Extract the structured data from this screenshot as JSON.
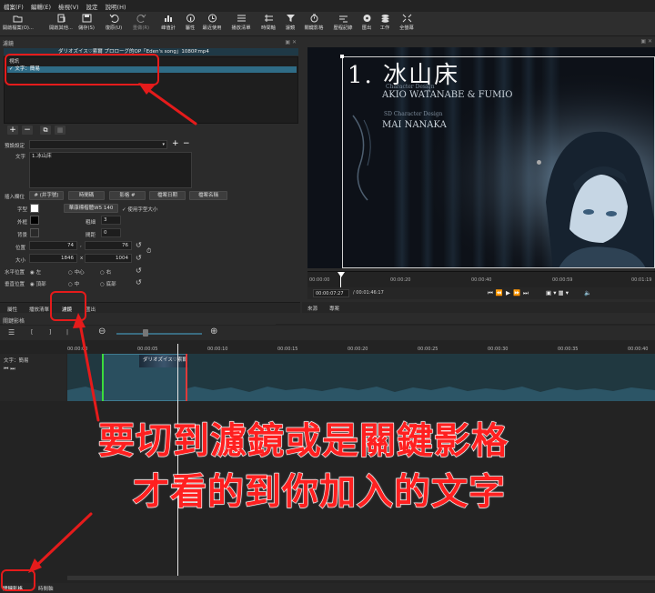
{
  "menu": {
    "items": [
      "檔案(F)",
      "編輯(E)",
      "檢視(V)",
      "設定",
      "說明(H)"
    ]
  },
  "toolbar": {
    "buttons": [
      {
        "label": "開啟檔案(O)...",
        "icon": "open-folder-icon"
      },
      {
        "label": "開啟其他...",
        "icon": "open-other-icon"
      },
      {
        "label": "儲存(S)",
        "icon": "save-icon"
      },
      {
        "label": "復原(U)",
        "icon": "undo-icon"
      },
      {
        "label": "重做(R)",
        "icon": "redo-icon"
      },
      {
        "label": "峰值計",
        "icon": "peak-meter-icon"
      },
      {
        "label": "屬性",
        "icon": "properties-icon"
      },
      {
        "label": "最近使用",
        "icon": "recent-icon"
      },
      {
        "label": "播放清單",
        "icon": "playlist-icon"
      },
      {
        "label": "時間軸",
        "icon": "timeline-icon"
      },
      {
        "label": "濾鏡",
        "icon": "filter-icon"
      },
      {
        "label": "關鍵影格",
        "icon": "keyframes-icon"
      },
      {
        "label": "歷程記錄",
        "icon": "history-icon"
      },
      {
        "label": "匯出",
        "icon": "export-icon"
      },
      {
        "label": "工作",
        "icon": "jobs-icon"
      },
      {
        "label": "全螢幕",
        "icon": "fullscreen-icon"
      }
    ]
  },
  "filters_panel": {
    "title": "濾鏡",
    "clip_name": "ダリオズイス♡索爾 プロローグ的ОP「Eden's song」1080P.mp4",
    "category": "視訊",
    "filter_item": "✓ 文字：簡易",
    "preset_label": "預設設定",
    "text_label": "文字",
    "text_value": "1.冰山床",
    "insert_field_label": "插入欄位",
    "insert_buttons": [
      "# (井字號)",
      "時間碼",
      "影格 #",
      "檔案日期",
      "檔案名稱"
    ],
    "font_label": "字型",
    "font_button": "華康標楷體W5 140",
    "use_font_size": "✓ 使用字型大小",
    "outline_label": "外框",
    "thickness_label": "粗細",
    "thickness_value": "3",
    "background_label": "背景",
    "padding_label": "間距",
    "padding_value": "0",
    "position_label": "位置",
    "pos_x": "74",
    "pos_y": "76",
    "size_label": "大小",
    "size_w": "1846",
    "size_h": "1004",
    "halign_label": "水平位置",
    "halign_options": [
      "左",
      "中心",
      "右"
    ],
    "valign_label": "垂直位置",
    "valign_options": [
      "頂部",
      "中",
      "底部"
    ],
    "tabs": [
      "屬性",
      "播放清單",
      "濾鏡",
      "匯出"
    ]
  },
  "preview": {
    "title_text": "1. 冰山床",
    "credit_small_1": "Character Design",
    "credit_line_1": "AKIO WATANABE & FUMIO",
    "credit_small_2": "SD Character Design",
    "credit_line_2": "MAI NANAKA",
    "ruler_ticks": [
      "00:00:00",
      "00:00:20",
      "00:00:40",
      "00:00:59",
      "00:01:19"
    ],
    "current_time": "00:00:07:27",
    "total_time": "/ 00:01:46:17",
    "source_tab": "來源",
    "project_tab": "專案"
  },
  "timeline": {
    "title": "關鍵影格",
    "ticks": [
      "00:00:00",
      "00:00:05",
      "00:00:10",
      "00:00:15",
      "00:00:20",
      "00:00:25",
      "00:00:30",
      "00:00:35",
      "00:00:40"
    ],
    "track_name": "文字：簡易",
    "clip_label": "ダリオズイス♡索爾",
    "bottom_tabs": [
      "關鍵影格",
      "時間軸"
    ]
  },
  "annotation": {
    "line1": "要切到濾鏡或是關鍵影格",
    "line2": "才看的到你加入的文字",
    "color": "#ff2020"
  }
}
